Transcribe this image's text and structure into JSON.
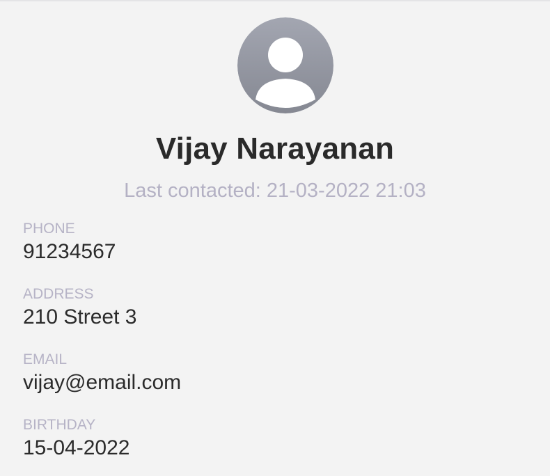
{
  "contact": {
    "name": "Vijay Narayanan",
    "last_contacted": "Last contacted: 21-03-2022 21:03",
    "avatar_icon": "person-silhouette-icon"
  },
  "fields": {
    "phone": {
      "label": "PHONE",
      "value": "91234567"
    },
    "address": {
      "label": "ADDRESS",
      "value": "210 Street 3"
    },
    "email": {
      "label": "EMAIL",
      "value": "vijay@email.com"
    },
    "birthday": {
      "label": "BIRTHDAY",
      "value": "15-04-2022"
    }
  },
  "colors": {
    "background": "#f3f3f3",
    "text_primary": "#2b2b2b",
    "text_muted": "#b4b1c4",
    "avatar_gradient_top": "#a3a6b1",
    "avatar_gradient_bottom": "#858892",
    "avatar_silhouette": "#ffffff"
  }
}
